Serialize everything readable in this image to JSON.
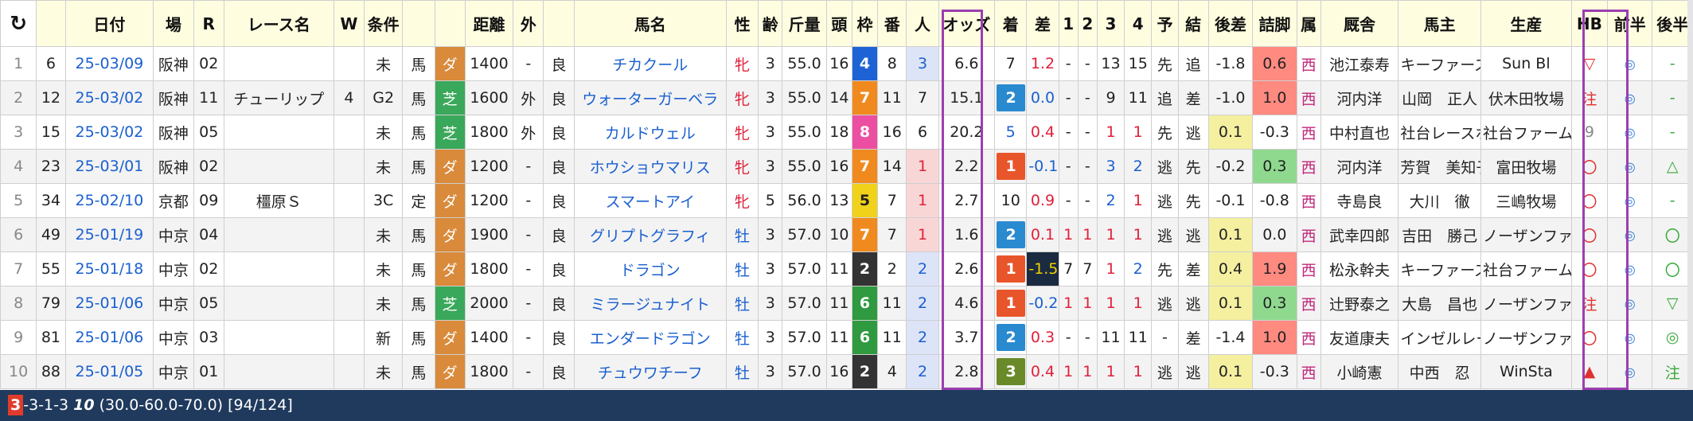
{
  "headers": [
    "",
    "",
    "日付",
    "場",
    "R",
    "レース名",
    "W",
    "条件",
    "",
    "",
    "距離",
    "外",
    "",
    "馬名",
    "性",
    "齢",
    "斤量",
    "頭",
    "枠",
    "番",
    "人",
    "オッズ",
    "着",
    "差",
    "1",
    "2",
    "3",
    "4",
    "予",
    "結",
    "後差",
    "詰脚",
    "属",
    "厩舎",
    "馬主",
    "生産",
    "HB",
    "前半",
    "後半"
  ],
  "refresh_icon": "refresh-icon",
  "colors": {
    "turf": "#3aa85a",
    "dirt": "#d98a3a",
    "accent_purple": "#9b3fb0",
    "frame_1": "#ffffff",
    "frame_2": "#333333",
    "frame_3": "#e53935",
    "frame_4": "#1e63d6",
    "frame_5": "#f1d21a",
    "frame_6": "#2f9a3f",
    "frame_7": "#f08a1e",
    "frame_8": "#ec4fa1"
  },
  "rows": [
    {
      "idx": "1",
      "n": "6",
      "date": "25-03/09",
      "track": "阪神",
      "r": "02",
      "race": "",
      "w": "",
      "cond": "未",
      "cls": "馬",
      "surf": "ダ",
      "dist": "1400",
      "out": "-",
      "going": "良",
      "horse": "チカクール",
      "sex": "牝",
      "age": "3",
      "kin": "55.0",
      "tou": "16",
      "waku": "4",
      "ban": "8",
      "pop": "3",
      "odds": "6.6",
      "fin": "7",
      "diff": "1.2",
      "c1": "-",
      "c2": "-",
      "c3": "13",
      "c4": "15",
      "yo": "先",
      "ke": "追",
      "kosa": "-1.8",
      "tsume": "0.6",
      "zoku": "西",
      "trainer": "池江泰寿",
      "owner": "キーファーズ",
      "breeder": "Sun Bl",
      "hb": "▽",
      "zen": "◎",
      "kou": "-"
    },
    {
      "idx": "2",
      "n": "12",
      "date": "25-03/02",
      "track": "阪神",
      "r": "11",
      "race": "チューリップ",
      "w": "4",
      "cond": "G2",
      "cls": "馬",
      "surf": "芝",
      "dist": "1600",
      "out": "外",
      "going": "良",
      "horse": "ウォーターガーベラ",
      "sex": "牝",
      "age": "3",
      "kin": "55.0",
      "tou": "14",
      "waku": "7",
      "ban": "11",
      "pop": "7",
      "odds": "15.1",
      "fin": "2",
      "diff": "0.0",
      "c1": "-",
      "c2": "-",
      "c3": "9",
      "c4": "11",
      "yo": "追",
      "ke": "差",
      "kosa": "-1.0",
      "tsume": "1.0",
      "zoku": "西",
      "trainer": "河内洋",
      "owner": "山岡　正人",
      "breeder": "伏木田牧場",
      "hb": "注",
      "zen": "◎",
      "kou": "-"
    },
    {
      "idx": "3",
      "n": "15",
      "date": "25-03/02",
      "track": "阪神",
      "r": "05",
      "race": "",
      "w": "",
      "cond": "未",
      "cls": "馬",
      "surf": "芝",
      "dist": "1800",
      "out": "外",
      "going": "良",
      "horse": "カルドウェル",
      "sex": "牝",
      "age": "3",
      "kin": "55.0",
      "tou": "18",
      "waku": "8",
      "ban": "16",
      "pop": "6",
      "odds": "20.2",
      "fin": "5",
      "diff": "0.4",
      "c1": "-",
      "c2": "-",
      "c3": "1",
      "c4": "1",
      "yo": "先",
      "ke": "逃",
      "kosa": "0.1",
      "tsume": "-0.3",
      "zoku": "西",
      "trainer": "中村直也",
      "owner": "社台レースホ",
      "breeder": "社台ファーム",
      "hb": "9",
      "zen": "◎",
      "kou": "-"
    },
    {
      "idx": "4",
      "n": "23",
      "date": "25-03/01",
      "track": "阪神",
      "r": "02",
      "race": "",
      "w": "",
      "cond": "未",
      "cls": "馬",
      "surf": "ダ",
      "dist": "1200",
      "out": "-",
      "going": "良",
      "horse": "ホウショウマリス",
      "sex": "牝",
      "age": "3",
      "kin": "55.0",
      "tou": "16",
      "waku": "7",
      "ban": "14",
      "pop": "1",
      "odds": "2.2",
      "fin": "1",
      "diff": "-0.1",
      "c1": "-",
      "c2": "-",
      "c3": "3",
      "c4": "2",
      "yo": "逃",
      "ke": "先",
      "kosa": "-0.2",
      "tsume": "0.3",
      "zoku": "西",
      "trainer": "河内洋",
      "owner": "芳賀　美知子",
      "breeder": "富田牧場",
      "hb": "〇",
      "zen": "◎",
      "kou": "△"
    },
    {
      "idx": "5",
      "n": "34",
      "date": "25-02/10",
      "track": "京都",
      "r": "09",
      "race": "橿原Ｓ",
      "w": "",
      "cond": "3C",
      "cls": "定",
      "surf": "ダ",
      "dist": "1200",
      "out": "-",
      "going": "良",
      "horse": "スマートアイ",
      "sex": "牝",
      "age": "5",
      "kin": "56.0",
      "tou": "13",
      "waku": "5",
      "ban": "7",
      "pop": "1",
      "odds": "2.7",
      "fin": "10",
      "diff": "0.9",
      "c1": "-",
      "c2": "-",
      "c3": "2",
      "c4": "1",
      "yo": "逃",
      "ke": "先",
      "kosa": "-0.1",
      "tsume": "-0.8",
      "zoku": "西",
      "trainer": "寺島良",
      "owner": "大川　徹",
      "breeder": "三嶋牧場",
      "hb": "〇",
      "zen": "◎",
      "kou": "-"
    },
    {
      "idx": "6",
      "n": "49",
      "date": "25-01/19",
      "track": "中京",
      "r": "04",
      "race": "",
      "w": "",
      "cond": "未",
      "cls": "馬",
      "surf": "ダ",
      "dist": "1900",
      "out": "-",
      "going": "良",
      "horse": "グリプトグラフィ",
      "sex": "牡",
      "age": "3",
      "kin": "57.0",
      "tou": "10",
      "waku": "7",
      "ban": "7",
      "pop": "1",
      "odds": "1.6",
      "fin": "2",
      "diff": "0.1",
      "c1": "1",
      "c2": "1",
      "c3": "1",
      "c4": "1",
      "yo": "逃",
      "ke": "逃",
      "kosa": "0.1",
      "tsume": "0.0",
      "zoku": "西",
      "trainer": "武幸四郎",
      "owner": "吉田　勝己",
      "breeder": "ノーザンファ",
      "hb": "〇",
      "zen": "◎",
      "kou": "〇"
    },
    {
      "idx": "7",
      "n": "55",
      "date": "25-01/18",
      "track": "中京",
      "r": "02",
      "race": "",
      "w": "",
      "cond": "未",
      "cls": "馬",
      "surf": "ダ",
      "dist": "1800",
      "out": "-",
      "going": "良",
      "horse": "ドラゴン",
      "sex": "牡",
      "age": "3",
      "kin": "57.0",
      "tou": "11",
      "waku": "2",
      "ban": "2",
      "pop": "2",
      "odds": "2.6",
      "fin": "1",
      "diff": "-1.5",
      "c1": "7",
      "c2": "7",
      "c3": "1",
      "c4": "2",
      "yo": "先",
      "ke": "差",
      "kosa": "0.4",
      "tsume": "1.9",
      "zoku": "西",
      "trainer": "松永幹夫",
      "owner": "キーファーズ",
      "breeder": "社台ファーム",
      "hb": "〇",
      "zen": "◎",
      "kou": "〇"
    },
    {
      "idx": "8",
      "n": "79",
      "date": "25-01/06",
      "track": "中京",
      "r": "05",
      "race": "",
      "w": "",
      "cond": "未",
      "cls": "馬",
      "surf": "芝",
      "dist": "2000",
      "out": "-",
      "going": "良",
      "horse": "ミラージュナイト",
      "sex": "牡",
      "age": "3",
      "kin": "57.0",
      "tou": "11",
      "waku": "6",
      "ban": "11",
      "pop": "2",
      "odds": "4.6",
      "fin": "1",
      "diff": "-0.2",
      "c1": "1",
      "c2": "1",
      "c3": "1",
      "c4": "1",
      "yo": "逃",
      "ke": "逃",
      "kosa": "0.1",
      "tsume": "0.3",
      "zoku": "西",
      "trainer": "辻野泰之",
      "owner": "大島　昌也",
      "breeder": "ノーザンファ",
      "hb": "注",
      "zen": "◎",
      "kou": "▽"
    },
    {
      "idx": "9",
      "n": "81",
      "date": "25-01/06",
      "track": "中京",
      "r": "03",
      "race": "",
      "w": "",
      "cond": "新",
      "cls": "馬",
      "surf": "ダ",
      "dist": "1400",
      "out": "-",
      "going": "良",
      "horse": "エンダードラゴン",
      "sex": "牡",
      "age": "3",
      "kin": "57.0",
      "tou": "11",
      "waku": "6",
      "ban": "11",
      "pop": "2",
      "odds": "3.7",
      "fin": "2",
      "diff": "0.3",
      "c1": "-",
      "c2": "-",
      "c3": "11",
      "c4": "11",
      "yo": "-",
      "ke": "差",
      "kosa": "-1.4",
      "tsume": "1.0",
      "zoku": "西",
      "trainer": "友道康夫",
      "owner": "インゼルレー",
      "breeder": "ノーザンファ",
      "hb": "〇",
      "zen": "◎",
      "kou": "◎"
    },
    {
      "idx": "10",
      "n": "88",
      "date": "25-01/05",
      "track": "中京",
      "r": "01",
      "race": "",
      "w": "",
      "cond": "未",
      "cls": "馬",
      "surf": "ダ",
      "dist": "1800",
      "out": "-",
      "going": "良",
      "horse": "チュウワチーフ",
      "sex": "牡",
      "age": "3",
      "kin": "57.0",
      "tou": "16",
      "waku": "2",
      "ban": "4",
      "pop": "2",
      "odds": "2.8",
      "fin": "3",
      "diff": "0.4",
      "c1": "1",
      "c2": "1",
      "c3": "1",
      "c4": "1",
      "yo": "逃",
      "ke": "逃",
      "kosa": "0.1",
      "tsume": "-0.3",
      "zoku": "西",
      "trainer": "小崎憲",
      "owner": "中西　忍",
      "breeder": "WinSta",
      "hb": "▲",
      "zen": "◎",
      "kou": "注"
    }
  ],
  "status": {
    "place": "3",
    "record": "-3-1-3",
    "count": "10",
    "rates": "(30.0-60.0-70.0)",
    "total": "[94/124]"
  }
}
